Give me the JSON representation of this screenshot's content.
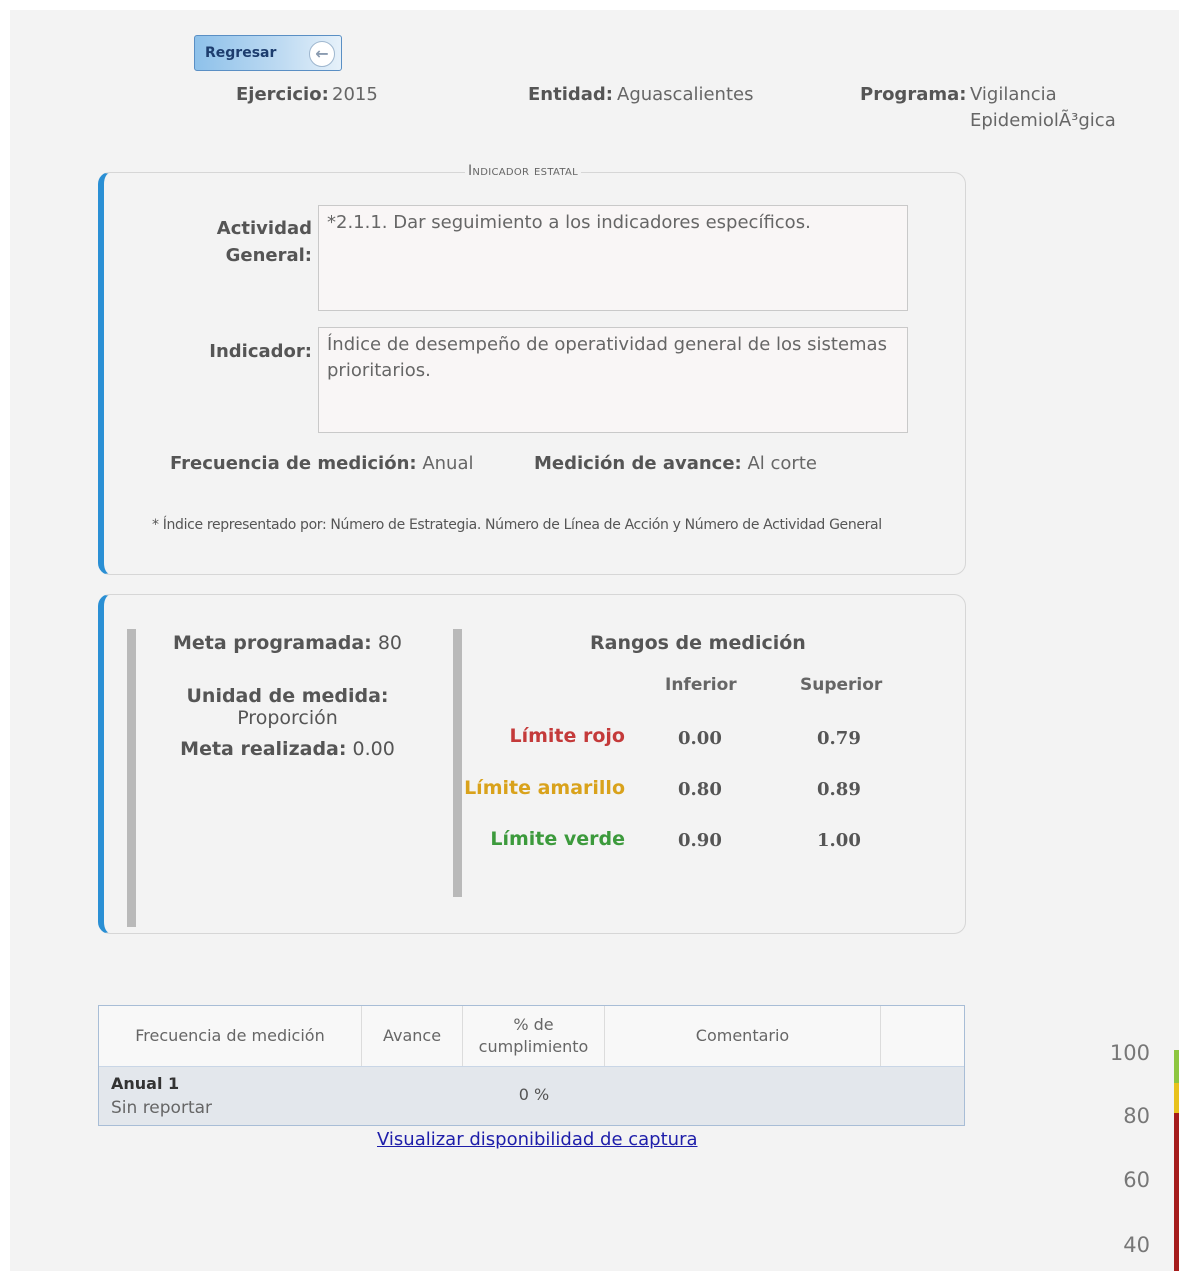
{
  "back_button": {
    "label": "Regresar",
    "icon": "arrow-left-icon"
  },
  "header": {
    "ejercicio_label": "Ejercicio:",
    "ejercicio_value": "2015",
    "entidad_label": "Entidad:",
    "entidad_value": "Aguascalientes",
    "programa_label": "Programa:",
    "programa_value_line1": "Vigilancia",
    "programa_value_line2": "EpidemiolÃ³gica"
  },
  "indicador_panel": {
    "legend": "Indicador estatal",
    "actividad_label_line1": "Actividad",
    "actividad_label_line2": "General:",
    "actividad_value": "*2.1.1. Dar seguimiento a los indicadores específicos.",
    "indicador_label": "Indicador:",
    "indicador_value": "Índice de desempeño de operatividad general de los sistemas prioritarios.",
    "frecuencia_label": "Frecuencia de medición:",
    "frecuencia_value": "Anual",
    "medicion_label": "Medición de avance:",
    "medicion_value": "Al corte",
    "footnote": "* Índice representado por: Número de Estrategia. Número de Línea de Acción y Número de Actividad General"
  },
  "meta_panel": {
    "meta_programada_label": "Meta programada:",
    "meta_programada_value": "80",
    "unidad_label": "Unidad de medida:",
    "unidad_value": "Proporción",
    "meta_realizada_label": "Meta realizada:",
    "meta_realizada_value": "0.00",
    "rangos_title": "Rangos de medición",
    "col_inferior": "Inferior",
    "col_superior": "Superior",
    "rows": [
      {
        "label": "Límite rojo",
        "color": "#c43a3a",
        "inferior": "0.00",
        "superior": "0.79"
      },
      {
        "label": "Límite amarillo",
        "color": "#d9a21b",
        "inferior": "0.80",
        "superior": "0.89"
      },
      {
        "label": "Límite verde",
        "color": "#3c9a3c",
        "inferior": "0.90",
        "superior": "1.00"
      }
    ]
  },
  "table": {
    "headers": [
      "Frecuencia de medición",
      "Avance",
      "% de cumplimiento",
      "Comentario",
      ""
    ],
    "rows": [
      {
        "periodo": "Anual 1",
        "estado": "Sin reportar",
        "avance": "",
        "cumplimiento": "0 %",
        "comentario": ""
      }
    ]
  },
  "link_text": "Visualizar disponibilidad de captura",
  "gauge": {
    "ticks": [
      "100",
      "80",
      "60",
      "40"
    ],
    "colors": {
      "green": "#8dc63f",
      "yellow": "#e8c21c",
      "red": "#a51c1c"
    }
  }
}
